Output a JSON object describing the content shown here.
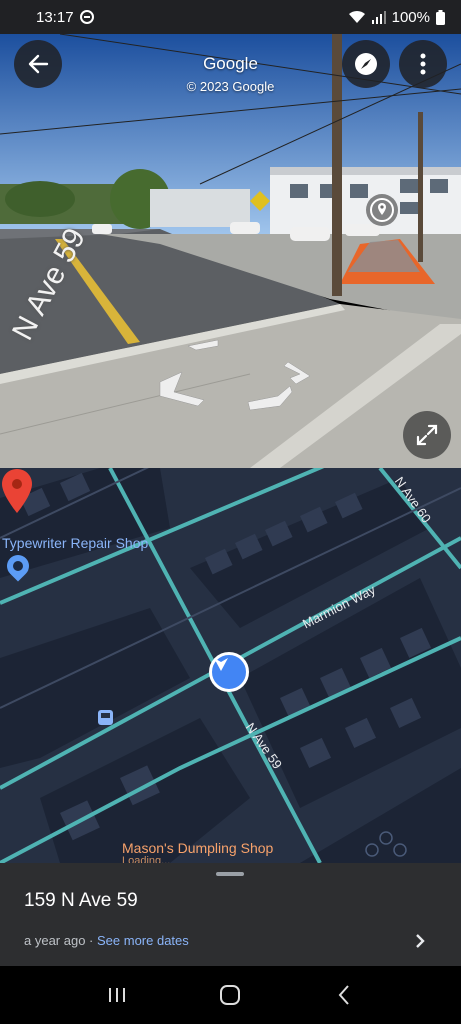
{
  "status_bar": {
    "time": "13:17",
    "battery": "100%"
  },
  "street_view": {
    "title": "Google",
    "copyright": "© 2023 Google",
    "street_label": "N Ave 59"
  },
  "map": {
    "poi_typewriter": "Typewriter Repair Shop",
    "poi_masons": "Mason's Dumpling Shop",
    "poi_masons_sub": "Loading...",
    "road_marmion": "Marmion Way",
    "road_nave59": "N Ave 59",
    "road_nave60": "N Ave 60"
  },
  "sheet": {
    "address": "159 N Ave 59",
    "age": "a year ago",
    "separator": " · ",
    "more_dates": "See more dates"
  },
  "colors": {
    "map_bg": "#263043",
    "road_accent": "#4fb3b3",
    "pin_red": "#ea4335",
    "location_blue": "#4285f4",
    "link_blue": "#8ab4f8"
  },
  "icons": [
    "back-arrow-icon",
    "compass-icon",
    "more-vert-icon",
    "expand-icon",
    "location-pin-icon",
    "bus-stop-icon",
    "recents-icon",
    "home-icon",
    "nav-back-icon"
  ]
}
